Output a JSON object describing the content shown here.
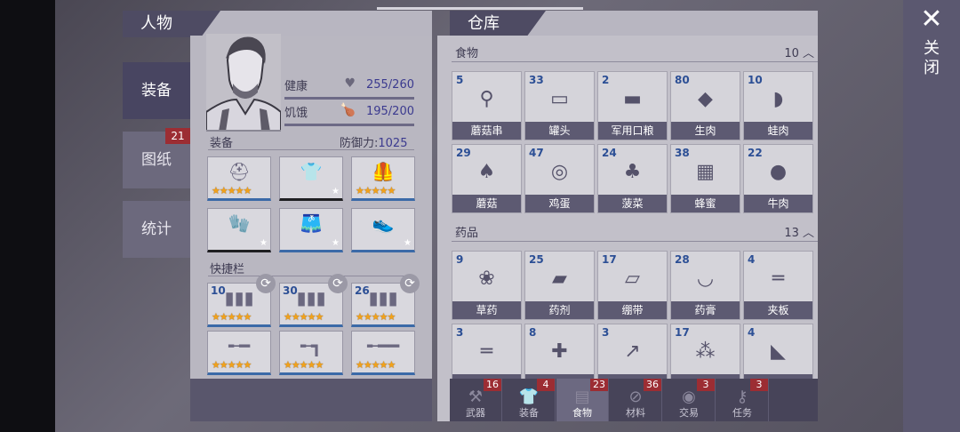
{
  "close": {
    "label": "关闭"
  },
  "left": {
    "title": "人物",
    "tabs": [
      {
        "label": "装备"
      },
      {
        "label": "图纸",
        "badge": "21"
      },
      {
        "label": "统计"
      }
    ],
    "stats": {
      "health_label": "健康",
      "health_value": "255/260",
      "hunger_label": "饥饿",
      "hunger_value": "195/200"
    },
    "equipment_label": "装备",
    "defense_label": "防御力:",
    "defense_value": "1025",
    "quickbar_label": "快捷栏",
    "ammo_counts": [
      "10",
      "30",
      "26"
    ],
    "equipment_icons": [
      "helmet-icon",
      "shirt-icon",
      "vest-icon",
      "gloves-icon",
      "shorts-icon",
      "shoes-icon"
    ],
    "quickbar_icons": [
      "ammo-icon",
      "ammo-icon",
      "ammo-icon",
      "shotgun-icon",
      "revolver-icon",
      "rifle-icon"
    ]
  },
  "right": {
    "title": "仓库",
    "food": {
      "label": "食物",
      "count": "10",
      "items": [
        {
          "num": "5",
          "name": "蘑菇串"
        },
        {
          "num": "33",
          "name": "罐头"
        },
        {
          "num": "2",
          "name": "军用口粮"
        },
        {
          "num": "80",
          "name": "生肉"
        },
        {
          "num": "10",
          "name": "蛙肉"
        },
        {
          "num": "29",
          "name": "蘑菇"
        },
        {
          "num": "47",
          "name": "鸡蛋"
        },
        {
          "num": "24",
          "name": "菠菜"
        },
        {
          "num": "38",
          "name": "蜂蜜"
        },
        {
          "num": "22",
          "name": "牛肉"
        }
      ]
    },
    "medicine": {
      "label": "药品",
      "count": "13",
      "items": [
        {
          "num": "9",
          "name": "草药"
        },
        {
          "num": "25",
          "name": "药剂"
        },
        {
          "num": "17",
          "name": "绷带"
        },
        {
          "num": "28",
          "name": "药膏"
        },
        {
          "num": "4",
          "name": "夹板"
        },
        {
          "num": "3",
          "name": ""
        },
        {
          "num": "8",
          "name": ""
        },
        {
          "num": "3",
          "name": ""
        },
        {
          "num": "17",
          "name": ""
        },
        {
          "num": "4",
          "name": ""
        }
      ]
    },
    "bottom_tabs": [
      {
        "label": "武器",
        "badge": "16"
      },
      {
        "label": "装备",
        "badge": "4"
      },
      {
        "label": "食物",
        "badge": "23"
      },
      {
        "label": "材料",
        "badge": "36"
      },
      {
        "label": "交易",
        "badge": "3"
      },
      {
        "label": "任务",
        "badge": "3"
      }
    ]
  }
}
